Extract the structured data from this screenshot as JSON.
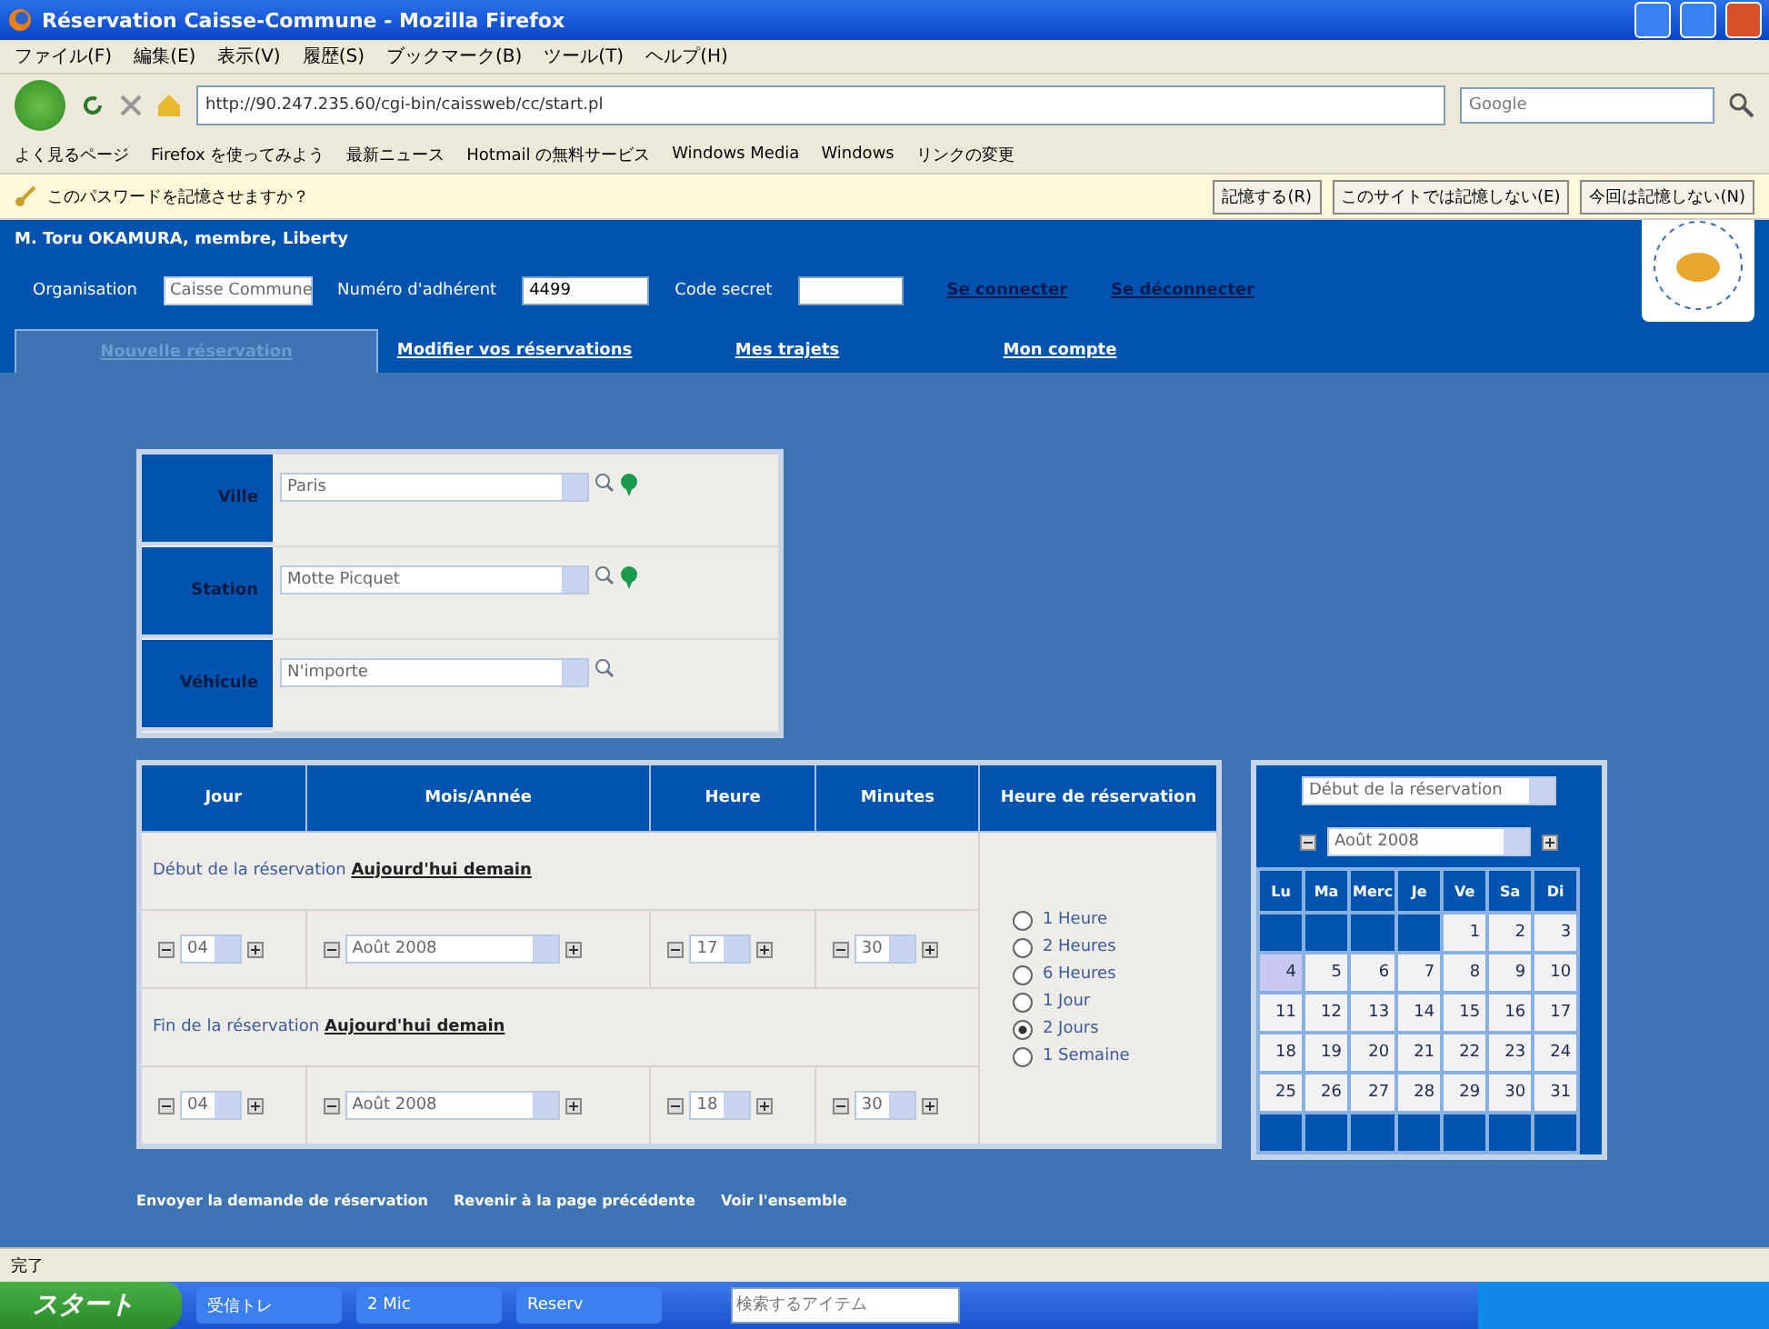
{
  "window": {
    "title": "Réservation Caisse-Commune - Mozilla Firefox"
  },
  "menu": [
    "ファイル(F)",
    "編集(E)",
    "表示(V)",
    "履歴(S)",
    "ブックマーク(B)",
    "ツール(T)",
    "ヘルプ(H)"
  ],
  "address": {
    "url": "http://90.247.235.60/cgi-bin/caissweb/cc/start.pl"
  },
  "search": {
    "placeholder": "Google"
  },
  "bookmarks": [
    "よく見るページ",
    "Firefox を使ってみよう",
    "最新ニュース",
    "Hotmail の無料サービス",
    "Windows Media",
    "Windows",
    "リンクの変更"
  ],
  "password_bar": {
    "message": "このパスワードを記憶させますか？",
    "buttons": [
      "記憶する(R)",
      "このサイトでは記憶しない(E)",
      "今回は記憶しない(N)"
    ]
  },
  "site": {
    "user": "M. Toru OKAMURA, membre, Liberty",
    "login": {
      "organisation_label": "Organisation",
      "organisation": "Caisse Commune",
      "member_label": "Numéro d'adhérent",
      "member": "4499",
      "code_label": "Code secret",
      "links": [
        "Se connecter",
        "Se déconnecter"
      ]
    },
    "tabs": [
      {
        "label": "Nouvelle réservation",
        "selected": true
      },
      {
        "label": "Modifier vos réservations",
        "selected": false
      },
      {
        "label": "Mes trajets",
        "selected": false
      },
      {
        "label": "Mon compte",
        "selected": false
      }
    ]
  },
  "station_form": [
    {
      "label": "Ville",
      "value": "Paris",
      "pin": true
    },
    {
      "label": "Station",
      "value": "Motte Picquet",
      "pin": true
    },
    {
      "label": "Véhicule",
      "value": "N'importe",
      "pin": false
    }
  ],
  "time_table": {
    "columns": [
      "Jour",
      "Mois/Année",
      "Heure",
      "Minutes",
      "Heure de réservation"
    ],
    "periods": [
      {
        "label": "Début de la réservation",
        "link": "Aujourd'hui demain",
        "day": "04",
        "month": "Août 2008",
        "hour": "17",
        "minute": "30"
      },
      {
        "label": "Fin de la réservation",
        "link": "Aujourd'hui demain",
        "day": "04",
        "month": "Août 2008",
        "hour": "18",
        "minute": "30"
      }
    ],
    "durations": [
      {
        "label": "1 Heure",
        "selected": false
      },
      {
        "label": "2 Heures",
        "selected": false
      },
      {
        "label": "6 Heures",
        "selected": false
      },
      {
        "label": "1 Jour",
        "selected": false
      },
      {
        "label": "2 Jours",
        "selected": true
      },
      {
        "label": "1 Semaine",
        "selected": false
      }
    ]
  },
  "calendar": {
    "mode": "Début de la réservation",
    "month": "Août 2008",
    "weekdays": [
      "Lu",
      "Ma",
      "Merc",
      "Je",
      "Ve",
      "Sa",
      "Di"
    ],
    "weeks": [
      [
        {
          "kind": "blank"
        },
        {
          "kind": "blank"
        },
        {
          "kind": "blank"
        },
        {
          "kind": "blank"
        },
        {
          "kind": "day",
          "label": "1",
          "selected": false
        },
        {
          "kind": "day",
          "label": "2",
          "selected": false
        },
        {
          "kind": "day",
          "label": "3",
          "selected": false
        }
      ],
      [
        {
          "kind": "day",
          "label": "4",
          "selected": true
        },
        {
          "kind": "day",
          "label": "5",
          "selected": false
        },
        {
          "kind": "day",
          "label": "6",
          "selected": false
        },
        {
          "kind": "day",
          "label": "7",
          "selected": false
        },
        {
          "kind": "day",
          "label": "8",
          "selected": false
        },
        {
          "kind": "day",
          "label": "9",
          "selected": false
        },
        {
          "kind": "day",
          "label": "10",
          "selected": false
        }
      ],
      [
        {
          "kind": "day",
          "label": "11",
          "selected": false
        },
        {
          "kind": "day",
          "label": "12",
          "selected": false
        },
        {
          "kind": "day",
          "label": "13",
          "selected": false
        },
        {
          "kind": "day",
          "label": "14",
          "selected": false
        },
        {
          "kind": "day",
          "label": "15",
          "selected": false
        },
        {
          "kind": "day",
          "label": "16",
          "selected": false
        },
        {
          "kind": "day",
          "label": "17",
          "selected": false
        }
      ],
      [
        {
          "kind": "day",
          "label": "18",
          "selected": false
        },
        {
          "kind": "day",
          "label": "19",
          "selected": false
        },
        {
          "kind": "day",
          "label": "20",
          "selected": false
        },
        {
          "kind": "day",
          "label": "21",
          "selected": false
        },
        {
          "kind": "day",
          "label": "22",
          "selected": false
        },
        {
          "kind": "day",
          "label": "23",
          "selected": false
        },
        {
          "kind": "day",
          "label": "24",
          "selected": false
        }
      ],
      [
        {
          "kind": "day",
          "label": "25",
          "selected": false
        },
        {
          "kind": "day",
          "label": "26",
          "selected": false
        },
        {
          "kind": "day",
          "label": "27",
          "selected": false
        },
        {
          "kind": "day",
          "label": "28",
          "selected": false
        },
        {
          "kind": "day",
          "label": "29",
          "selected": false
        },
        {
          "kind": "day",
          "label": "30",
          "selected": false
        },
        {
          "kind": "day",
          "label": "31",
          "selected": false
        }
      ],
      [
        {
          "kind": "blank"
        },
        {
          "kind": "blank"
        },
        {
          "kind": "blank"
        },
        {
          "kind": "blank"
        },
        {
          "kind": "blank"
        },
        {
          "kind": "blank"
        },
        {
          "kind": "blank"
        }
      ]
    ]
  },
  "actions": [
    "Envoyer la demande de réservation",
    "Revenir à la page précédente",
    "Voir l'ensemble"
  ],
  "status_bar": "完了",
  "taskbar": {
    "start": "スタート",
    "tasks": [
      "受信トレ",
      "2 Mic",
      "Reserv"
    ],
    "search_placeholder": "検索するアイテム"
  }
}
